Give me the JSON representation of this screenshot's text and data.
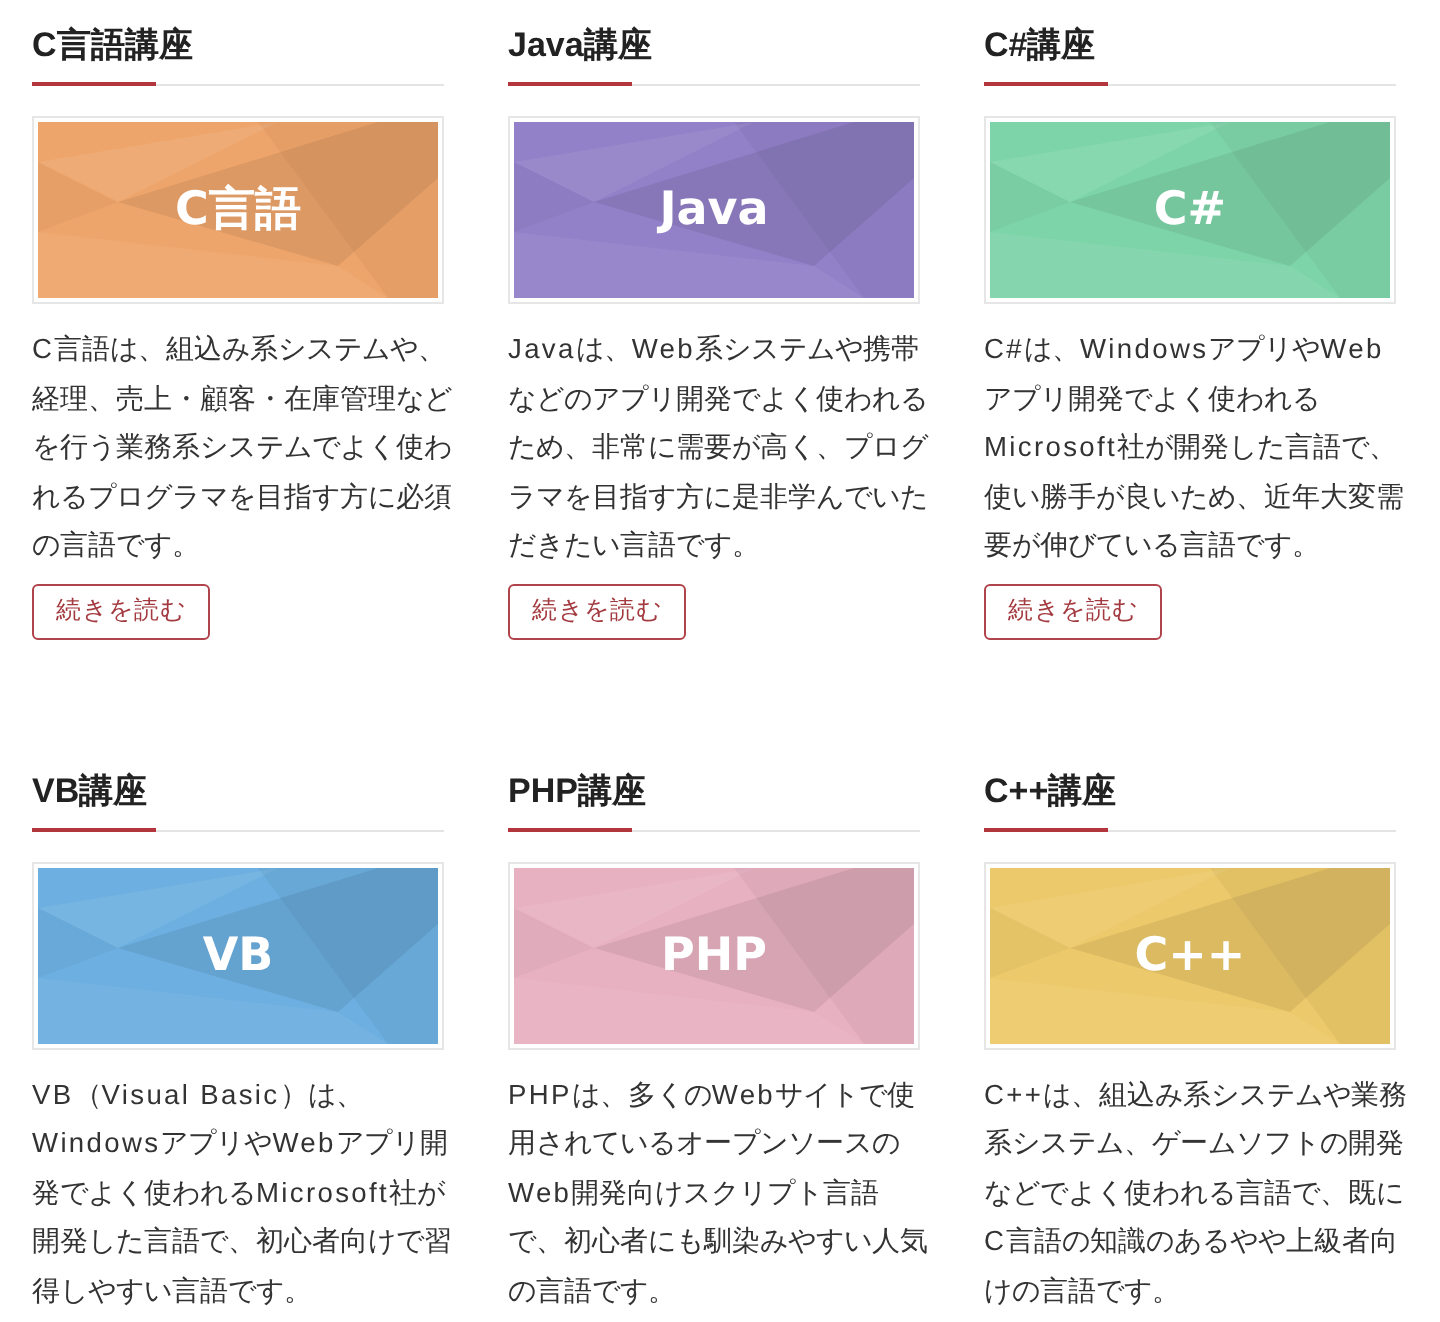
{
  "courses": [
    {
      "title": "C言語講座",
      "banner_label": "C言語",
      "color": "#eea56b",
      "description": "C言語は、組込み系システムや、経理、売上・顧客・在庫管理などを行う業務系システムでよく使われるプログラマを目指す方に必須の言語です。",
      "button": "続きを読む"
    },
    {
      "title": "Java講座",
      "banner_label": "Java",
      "color": "#9280c8",
      "description": "Javaは、Web系システムや携帯などのアプリ開発でよく使われるため、非常に需要が高く、プログラマを目指す方に是非学んでいただきたい言語です。",
      "button": "続きを読む"
    },
    {
      "title": "C#講座",
      "banner_label": "C#",
      "color": "#7ed4a9",
      "description": "C#は、WindowsアプリやWebアプリ開発でよく使われるMicrosoft社が開発した言語で、使い勝手が良いため、近年大変需要が伸びている言語です。",
      "button": "続きを読む"
    },
    {
      "title": "VB講座",
      "banner_label": "VB",
      "color": "#6cafe0",
      "description": "VB（Visual Basic）は、WindowsアプリやWebアプリ開発でよく使われるMicrosoft社が開発した言語で、初心者向けで習得しやすい言語です。"
    },
    {
      "title": "PHP講座",
      "banner_label": "PHP",
      "color": "#e8b1c2",
      "description": "PHPは、多くのWebサイトで使用されているオープンソースのWeb開発向けスクリプト言語で、初心者にも馴染みやすい人気の言語です。"
    },
    {
      "title": "C++講座",
      "banner_label": "C++",
      "color": "#ecc96a",
      "description": "C++は、組込み系システムや業務系システム、ゲームソフトの開発などでよく使われる言語で、既にC言語の知識のあるやや上級者向けの言語です。"
    }
  ]
}
